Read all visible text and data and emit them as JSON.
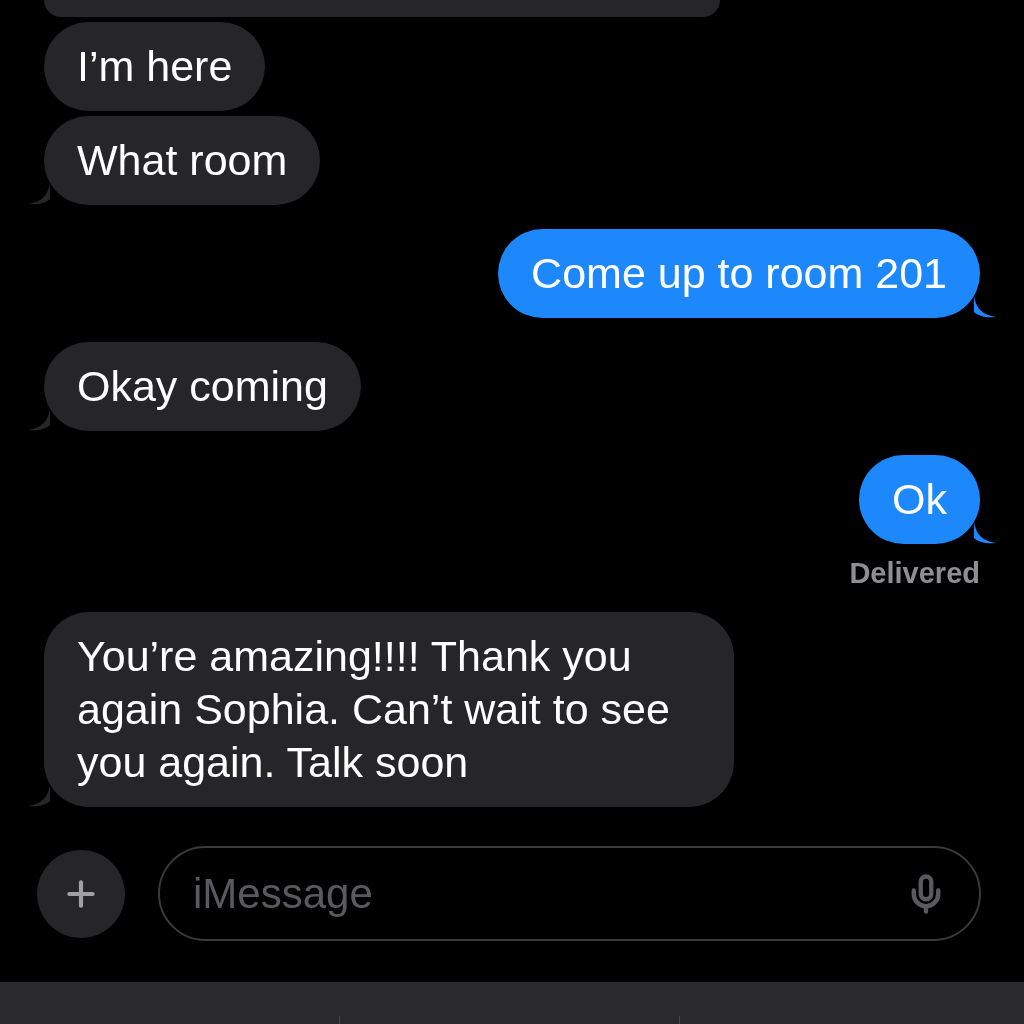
{
  "messages": [
    {
      "kind": "cut"
    },
    {
      "kind": "received",
      "text": "I’m here",
      "tail": false
    },
    {
      "kind": "received",
      "text": "What room",
      "tail": true
    },
    {
      "kind": "sent",
      "text": "Come up to room 201",
      "tail": true
    },
    {
      "kind": "received",
      "text": "Okay coming",
      "tail": true
    },
    {
      "kind": "sent",
      "text": "Ok",
      "tail": true,
      "status": "Delivered"
    },
    {
      "kind": "received",
      "text": "You’re amazing!!!! Thank you again Sophia. Can’t wait to see you again. Talk soon",
      "tail": true
    }
  ],
  "composer": {
    "placeholder": "iMessage"
  }
}
